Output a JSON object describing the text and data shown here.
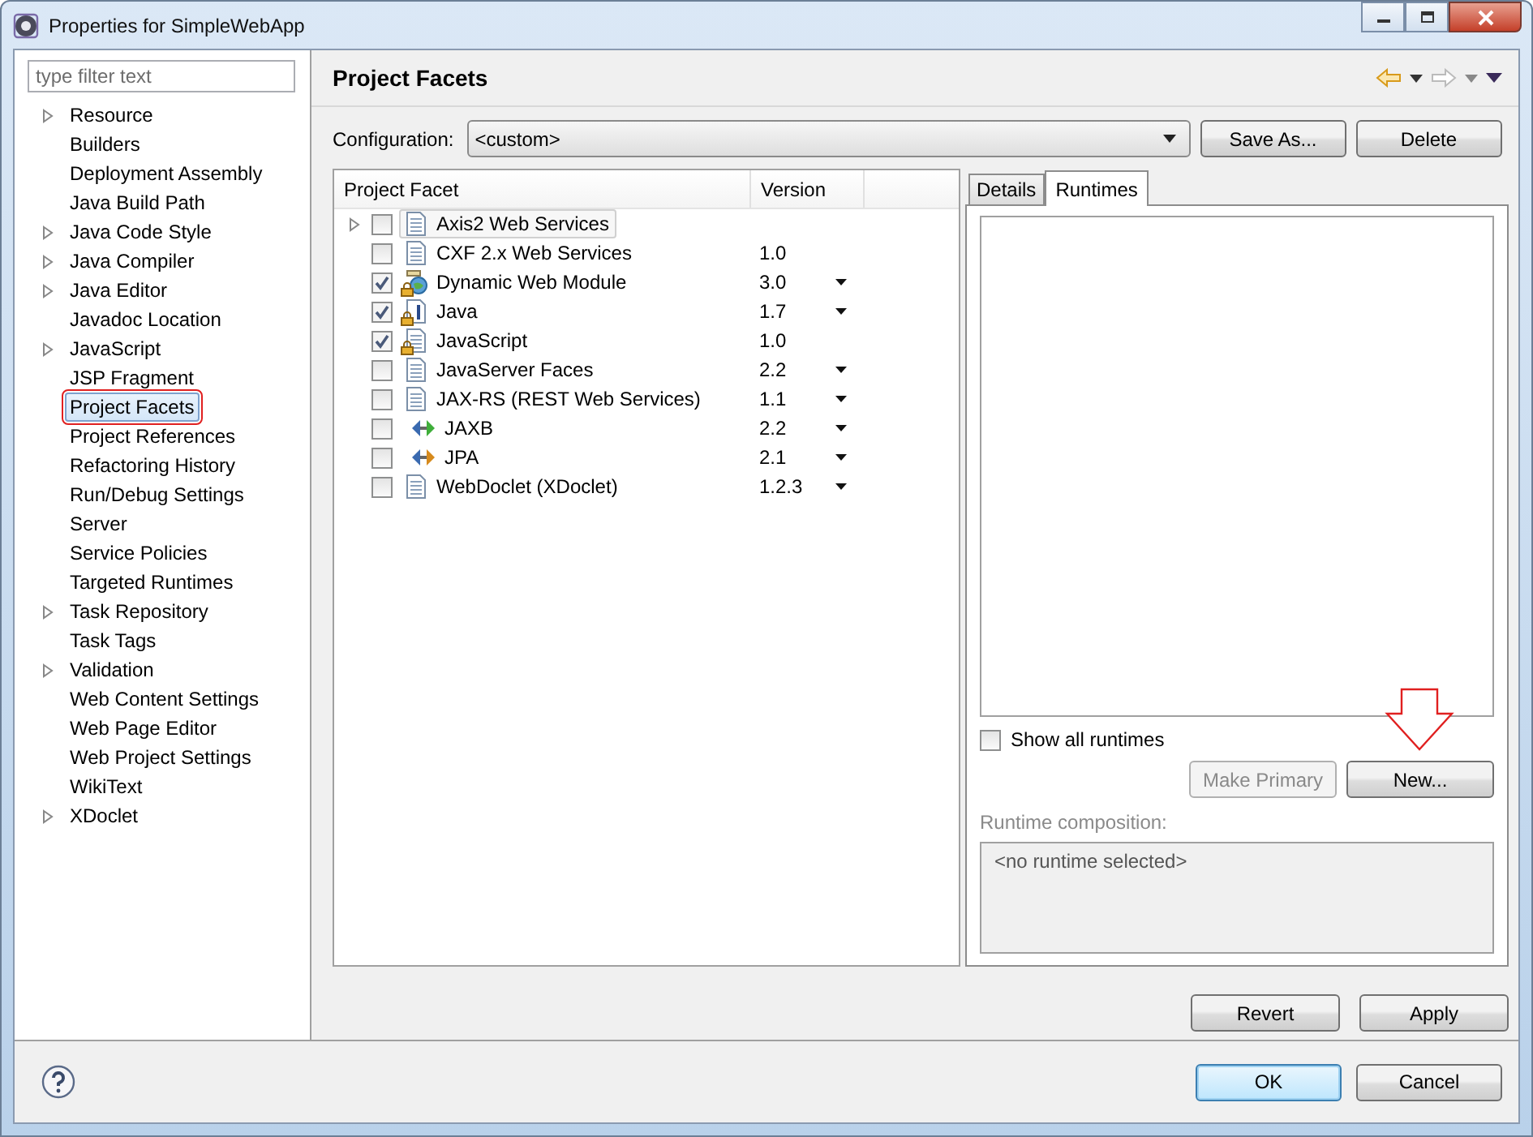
{
  "window": {
    "title": "Properties for SimpleWebApp"
  },
  "filter": {
    "placeholder": "type filter text"
  },
  "nav_tree": [
    {
      "label": "Resource",
      "expandable": true,
      "selected": false
    },
    {
      "label": "Builders",
      "expandable": false,
      "selected": false
    },
    {
      "label": "Deployment Assembly",
      "expandable": false,
      "selected": false
    },
    {
      "label": "Java Build Path",
      "expandable": false,
      "selected": false
    },
    {
      "label": "Java Code Style",
      "expandable": true,
      "selected": false
    },
    {
      "label": "Java Compiler",
      "expandable": true,
      "selected": false
    },
    {
      "label": "Java Editor",
      "expandable": true,
      "selected": false
    },
    {
      "label": "Javadoc Location",
      "expandable": false,
      "selected": false
    },
    {
      "label": "JavaScript",
      "expandable": true,
      "selected": false
    },
    {
      "label": "JSP Fragment",
      "expandable": false,
      "selected": false
    },
    {
      "label": "Project Facets",
      "expandable": false,
      "selected": true
    },
    {
      "label": "Project References",
      "expandable": false,
      "selected": false
    },
    {
      "label": "Refactoring History",
      "expandable": false,
      "selected": false
    },
    {
      "label": "Run/Debug Settings",
      "expandable": false,
      "selected": false
    },
    {
      "label": "Server",
      "expandable": false,
      "selected": false
    },
    {
      "label": "Service Policies",
      "expandable": false,
      "selected": false
    },
    {
      "label": "Targeted Runtimes",
      "expandable": false,
      "selected": false
    },
    {
      "label": "Task Repository",
      "expandable": true,
      "selected": false
    },
    {
      "label": "Task Tags",
      "expandable": false,
      "selected": false
    },
    {
      "label": "Validation",
      "expandable": true,
      "selected": false
    },
    {
      "label": "Web Content Settings",
      "expandable": false,
      "selected": false
    },
    {
      "label": "Web Page Editor",
      "expandable": false,
      "selected": false
    },
    {
      "label": "Web Project Settings",
      "expandable": false,
      "selected": false
    },
    {
      "label": "WikiText",
      "expandable": false,
      "selected": false
    },
    {
      "label": "XDoclet",
      "expandable": true,
      "selected": false
    }
  ],
  "page": {
    "title": "Project Facets"
  },
  "configuration": {
    "label": "Configuration:",
    "value": "<custom>"
  },
  "config_buttons": [
    "Save As...",
    "Delete"
  ],
  "facets": {
    "columns": [
      "Project Facet",
      "Version"
    ],
    "rows": [
      {
        "kind": "document",
        "name": "Axis2 Web Services",
        "checked": false,
        "locked": false,
        "dropdown": false,
        "expandable": true,
        "selected": true
      },
      {
        "kind": "document",
        "name": "CXF 2.x Web Services",
        "version": "1.0",
        "checked": false,
        "locked": false,
        "dropdown": false,
        "expandable": false,
        "selected": false
      },
      {
        "kind": "web-module",
        "name": "Dynamic Web Module",
        "version": "3.0",
        "checked": true,
        "locked": true,
        "dropdown": true,
        "expandable": false,
        "selected": false
      },
      {
        "kind": "java",
        "name": "Java",
        "version": "1.7",
        "checked": true,
        "locked": true,
        "dropdown": true,
        "expandable": false,
        "selected": false
      },
      {
        "kind": "document",
        "name": "JavaScript",
        "version": "1.0",
        "checked": true,
        "locked": true,
        "dropdown": false,
        "expandable": false,
        "selected": false
      },
      {
        "kind": "document",
        "name": "JavaServer Faces",
        "version": "2.2",
        "checked": false,
        "locked": false,
        "dropdown": true,
        "expandable": false,
        "selected": false
      },
      {
        "kind": "document",
        "name": "JAX-RS (REST Web Services)",
        "version": "1.1",
        "checked": false,
        "locked": false,
        "dropdown": true,
        "expandable": false,
        "selected": false
      },
      {
        "kind": "arrows",
        "color": "#3fae3a",
        "name": "JAXB",
        "version": "2.2",
        "checked": false,
        "locked": false,
        "dropdown": true,
        "expandable": false,
        "selected": false
      },
      {
        "kind": "arrows",
        "color": "#d68a1c",
        "name": "JPA",
        "version": "2.1",
        "checked": false,
        "locked": false,
        "dropdown": true,
        "expandable": false,
        "selected": false
      },
      {
        "kind": "document",
        "name": "WebDoclet (XDoclet)",
        "version": "1.2.3",
        "checked": false,
        "locked": false,
        "dropdown": true,
        "expandable": false,
        "selected": false
      }
    ]
  },
  "tabs": [
    {
      "label": "Details",
      "selected": false
    },
    {
      "label": "Runtimes",
      "selected": true
    }
  ],
  "show_all": {
    "label": "Show all runtimes",
    "checked": false
  },
  "runtime_buttons": [
    {
      "label": "Make Primary",
      "disabled": true
    },
    {
      "label": "New...",
      "disabled": false
    }
  ],
  "composition": {
    "label": "Runtime composition:",
    "disabled": true,
    "value": "<no runtime selected>"
  },
  "page_buttons": [
    "Revert",
    "Apply"
  ],
  "dialog_buttons": [
    {
      "label": "OK",
      "default": true
    },
    {
      "label": "Cancel",
      "default": false
    }
  ]
}
